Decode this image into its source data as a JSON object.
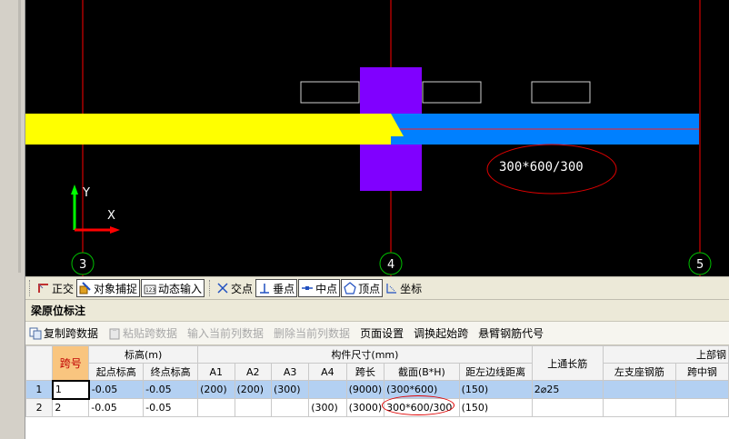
{
  "canvas": {
    "axis_labels": [
      "3",
      "4",
      "5"
    ],
    "dimension_label": "300*600/300",
    "ucs": {
      "x": "X",
      "y": "Y"
    },
    "colors": {
      "beam_left": "#ffff00",
      "beam_right": "#0080ff",
      "column": "#8000ff",
      "axis": "#ff0000",
      "ucs_x": "#ff0000",
      "ucs_y": "#00ff00"
    }
  },
  "snap_toolbar": {
    "items": [
      {
        "label": "正交",
        "icon": "ortho-icon",
        "pressed": false
      },
      {
        "label": "对象捕捉",
        "icon": "object-snap-icon",
        "pressed": true
      },
      {
        "label": "动态输入",
        "icon": "dynamic-input-icon",
        "pressed": true
      },
      {
        "label": "交点",
        "icon": "intersection-icon",
        "pressed": false
      },
      {
        "label": "垂点",
        "icon": "perpendicular-icon",
        "pressed": true
      },
      {
        "label": "中点",
        "icon": "midpoint-icon",
        "pressed": true
      },
      {
        "label": "顶点",
        "icon": "vertex-icon",
        "pressed": true
      },
      {
        "label": "坐标",
        "icon": "coordinate-icon",
        "pressed": false
      }
    ]
  },
  "panel": {
    "title": "梁原位标注",
    "toolbar": {
      "copy_span": "复制跨数据",
      "paste_span": "粘贴跨数据",
      "input_column": "输入当前列数据",
      "delete_column": "删除当前列数据",
      "page_setup": "页面设置",
      "swap_start": "调换起始跨",
      "cantilever_code": "悬臂钢筋代号"
    }
  },
  "table": {
    "group_headers": {
      "span_no": "跨号",
      "elevation": "标高(m)",
      "dimensions": "构件尺寸(mm)",
      "top_long_bar": "上通长筋",
      "top_bar": "上部钢"
    },
    "sub_headers": {
      "start_elev": "起点标高",
      "end_elev": "终点标高",
      "a1": "A1",
      "a2": "A2",
      "a3": "A3",
      "a4": "A4",
      "span_len": "跨长",
      "section": "截面(B*H)",
      "edge_dist": "距左边线距离",
      "left_support": "左支座钢筋",
      "mid_span": "跨中钢"
    },
    "rows": [
      {
        "row_no": "1",
        "span": "1",
        "start": "-0.05",
        "end": "-0.05",
        "a1": "(200)",
        "a2": "(200)",
        "a3": "(300)",
        "a4": "",
        "span_len": "(9000)",
        "section": "(300*600)",
        "edge_dist": "(150)",
        "top_long": "2⌀25",
        "left_support": "",
        "mid_span": ""
      },
      {
        "row_no": "2",
        "span": "2",
        "start": "-0.05",
        "end": "-0.05",
        "a1": "",
        "a2": "",
        "a3": "",
        "a4": "(300)",
        "span_len": "(3000)",
        "section": "300*600/300",
        "edge_dist": "(150)",
        "top_long": "",
        "left_support": "",
        "mid_span": ""
      }
    ]
  }
}
